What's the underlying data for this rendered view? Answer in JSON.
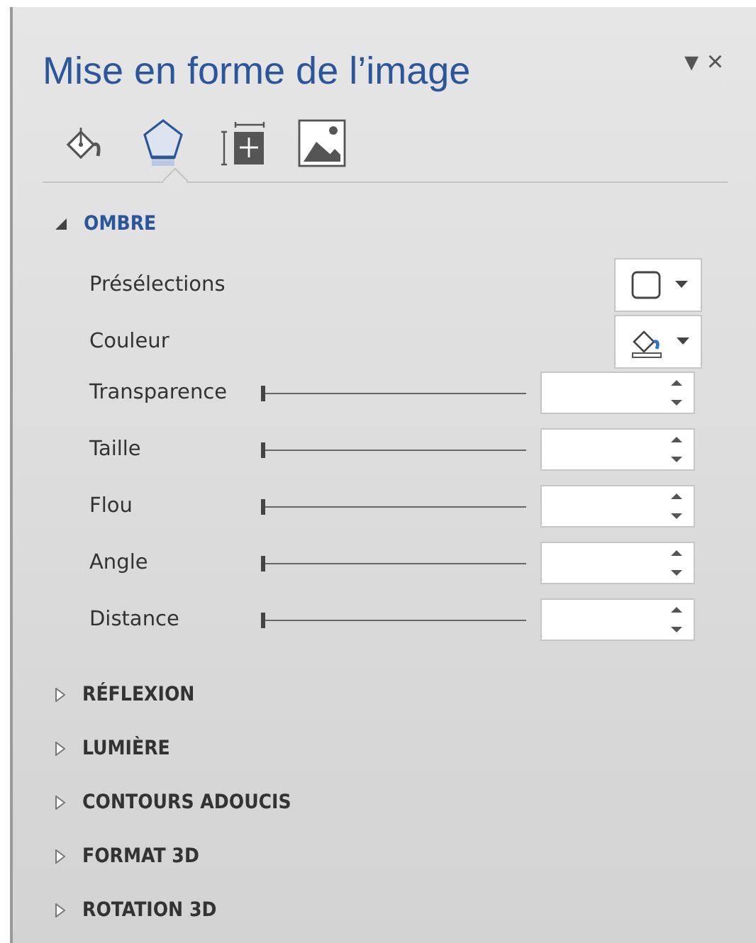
{
  "pane": {
    "title": "Mise en forme de l’image",
    "menu_glyph": "▾",
    "close_glyph": "×"
  },
  "tabs": [
    {
      "selected": false
    },
    {
      "selected": true
    },
    {
      "selected": false
    },
    {
      "selected": false
    }
  ],
  "sections": [
    {
      "title": "OMBRE",
      "expanded": true,
      "rows": [
        {
          "kind": "dropdown",
          "label": "Présélections"
        },
        {
          "kind": "dropdown",
          "label": "Couleur"
        },
        {
          "kind": "slider",
          "label": "Transparence",
          "level": 0
        },
        {
          "kind": "slider",
          "label": "Taille",
          "level": 0
        },
        {
          "kind": "slider",
          "label": "Flou",
          "level": 0
        },
        {
          "kind": "slider",
          "label": "Angle",
          "level": 0
        },
        {
          "kind": "slider",
          "label": "Distance",
          "level": 0
        }
      ]
    },
    {
      "title": "RÉFLEXION",
      "expanded": false
    },
    {
      "title": "LUMIÈRE",
      "expanded": false
    },
    {
      "title": "CONTOURS ADOUCIS",
      "expanded": false
    },
    {
      "title": "FORMAT 3D",
      "expanded": false
    },
    {
      "title": "ROTATION 3D",
      "expanded": false
    }
  ]
}
